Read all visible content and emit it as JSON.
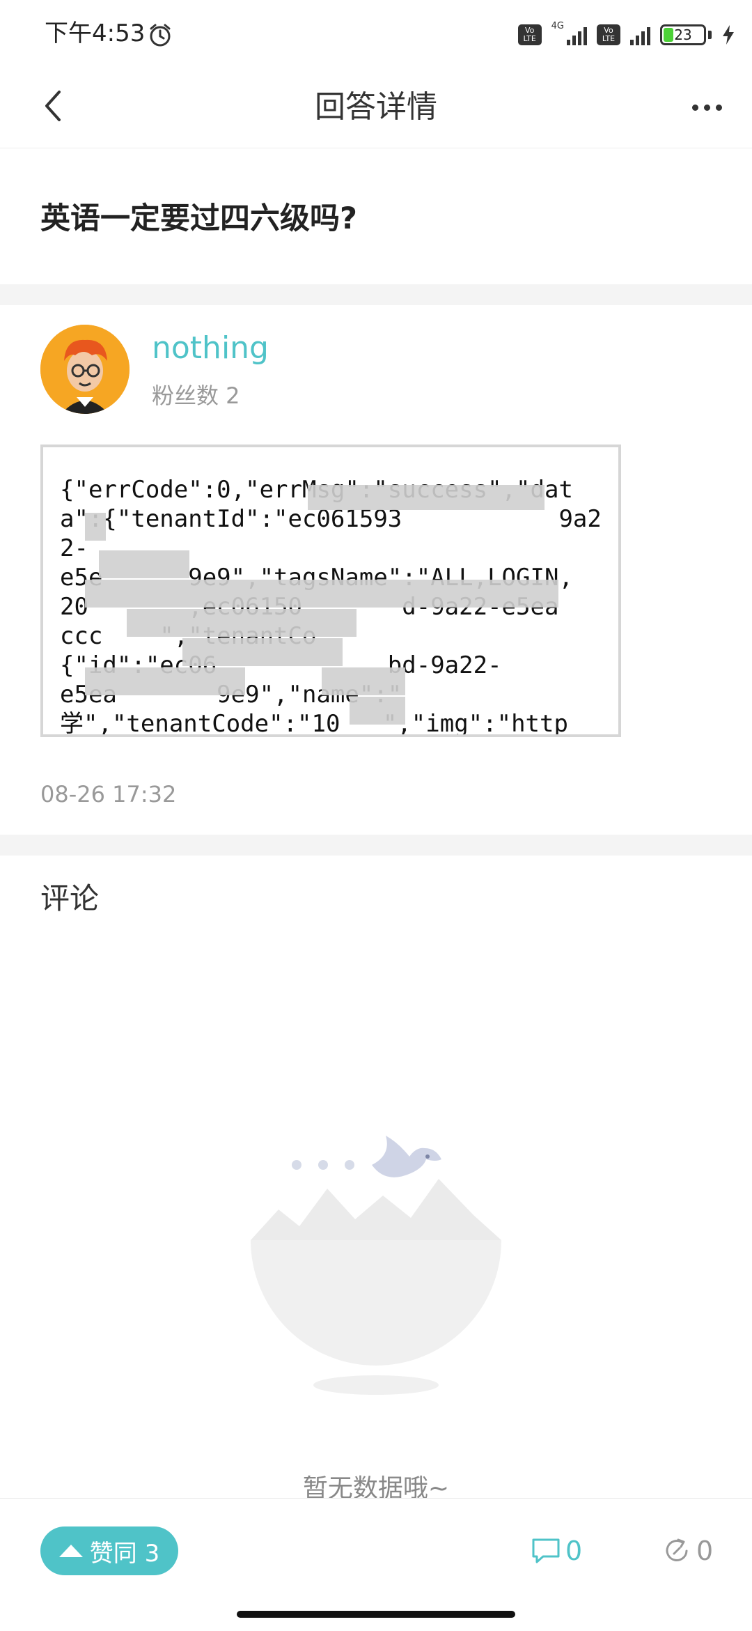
{
  "status_bar": {
    "time": "下午4:53",
    "network": "4G",
    "volte_label": "Vo LTE",
    "battery": "23"
  },
  "nav": {
    "title": "回答详情"
  },
  "question": {
    "title": "英语一定要过四六级吗?"
  },
  "author": {
    "name": "nothing",
    "fans": "粉丝数 2"
  },
  "answer": {
    "content": "{\"errCode\":0,\"errMsg\":\"success\",\"data\":{\"tenantId\":\"ec061593           9a22-\ne5e      9e9\",\"tagsName\":\"ALL,LOGIN,\n20       ,ec06150       d-9a22-e5ea\nccc    \",\"tenantCo\n{\"id\":\"ec06            bd-9a22-\ne5ea       9e9\",\"name\":\"\n学\",\"tenantCode\":\"10   \",\"img\":\"http",
    "time": "08-26 17:32"
  },
  "comments": {
    "title": "评论",
    "empty_text": "暂无数据哦~"
  },
  "actions": {
    "like_label": "赞同 3",
    "comment_count": "0",
    "share_count": "0"
  },
  "colors": {
    "accent": "#4fc3c8",
    "muted": "#999999",
    "divider": "#f4f4f4"
  }
}
